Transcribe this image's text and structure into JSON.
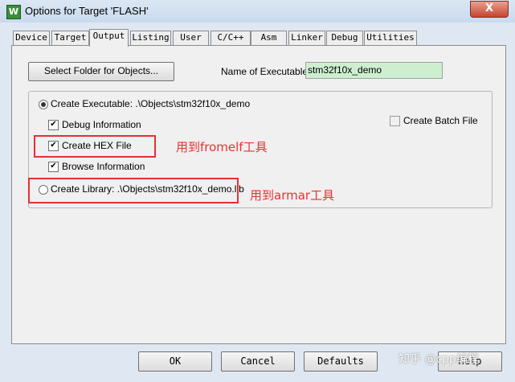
{
  "window": {
    "title": "Options for Target 'FLASH'",
    "close_glyph": "X",
    "app_icon": "W"
  },
  "tabs": [
    {
      "label": "Device"
    },
    {
      "label": "Target"
    },
    {
      "label": "Output",
      "active": true
    },
    {
      "label": "Listing"
    },
    {
      "label": "User"
    },
    {
      "label": "C/C++"
    },
    {
      "label": "Asm"
    },
    {
      "label": "Linker"
    },
    {
      "label": "Debug"
    },
    {
      "label": "Utilities"
    }
  ],
  "output": {
    "select_folder_button": "Select Folder for Objects...",
    "name_exe_label": "Name of Executable:",
    "name_exe_value": "stm32f10x_demo",
    "create_exe_label": "Create Executable:  .\\Objects\\stm32f10x_demo",
    "debug_info_label": "Debug Information",
    "create_hex_label": "Create HEX File",
    "browse_info_label": "Browse Information",
    "create_batch_label": "Create Batch File",
    "create_lib_label": "Create Library:  .\\Objects\\stm32f10x_demo.lib"
  },
  "annotations": {
    "hex_note": "用到fromelf工具",
    "lib_note": "用到armar工具"
  },
  "buttons": {
    "ok": "OK",
    "cancel": "Cancel",
    "defaults": "Defaults",
    "help": "Help"
  },
  "watermark": "知乎 @cpp编程",
  "icons": {
    "check": "checkmark-icon"
  }
}
